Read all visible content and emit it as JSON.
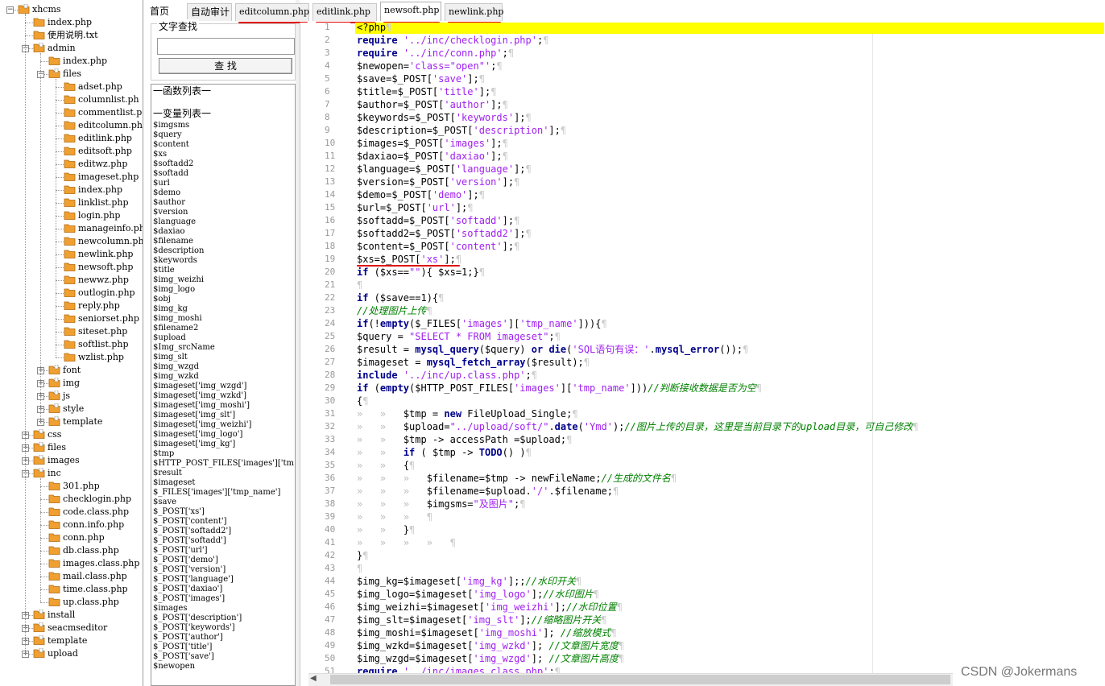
{
  "tree": [
    {
      "label": "xhcms",
      "depth": 0,
      "expander": "-",
      "folder": true
    },
    {
      "label": "index.php",
      "depth": 1,
      "folder": false
    },
    {
      "label": "使用说明.txt",
      "depth": 1,
      "folder": false
    },
    {
      "label": "admin",
      "depth": 1,
      "expander": "-",
      "folder": true
    },
    {
      "label": "index.php",
      "depth": 2,
      "folder": false
    },
    {
      "label": "files",
      "depth": 2,
      "expander": "-",
      "folder": true
    },
    {
      "label": "adset.php",
      "depth": 3,
      "folder": false
    },
    {
      "label": "columnlist.ph",
      "depth": 3,
      "folder": false
    },
    {
      "label": "commentlist.p",
      "depth": 3,
      "folder": false
    },
    {
      "label": "editcolumn.ph",
      "depth": 3,
      "folder": false
    },
    {
      "label": "editlink.php",
      "depth": 3,
      "folder": false
    },
    {
      "label": "editsoft.php",
      "depth": 3,
      "folder": false
    },
    {
      "label": "editwz.php",
      "depth": 3,
      "folder": false
    },
    {
      "label": "imageset.php",
      "depth": 3,
      "folder": false
    },
    {
      "label": "index.php",
      "depth": 3,
      "folder": false
    },
    {
      "label": "linklist.php",
      "depth": 3,
      "folder": false
    },
    {
      "label": "login.php",
      "depth": 3,
      "folder": false
    },
    {
      "label": "manageinfo.ph",
      "depth": 3,
      "folder": false
    },
    {
      "label": "newcolumn.php",
      "depth": 3,
      "folder": false
    },
    {
      "label": "newlink.php",
      "depth": 3,
      "folder": false
    },
    {
      "label": "newsoft.php",
      "depth": 3,
      "folder": false
    },
    {
      "label": "newwz.php",
      "depth": 3,
      "folder": false
    },
    {
      "label": "outlogin.php",
      "depth": 3,
      "folder": false
    },
    {
      "label": "reply.php",
      "depth": 3,
      "folder": false
    },
    {
      "label": "seniorset.php",
      "depth": 3,
      "folder": false
    },
    {
      "label": "siteset.php",
      "depth": 3,
      "folder": false
    },
    {
      "label": "softlist.php",
      "depth": 3,
      "folder": false
    },
    {
      "label": "wzlist.php",
      "depth": 3,
      "folder": false
    },
    {
      "label": "font",
      "depth": 2,
      "expander": "+",
      "folder": true
    },
    {
      "label": "img",
      "depth": 2,
      "expander": "+",
      "folder": true
    },
    {
      "label": "js",
      "depth": 2,
      "expander": "+",
      "folder": true
    },
    {
      "label": "style",
      "depth": 2,
      "expander": "+",
      "folder": true
    },
    {
      "label": "template",
      "depth": 2,
      "expander": "+",
      "folder": true
    },
    {
      "label": "css",
      "depth": 1,
      "expander": "+",
      "folder": true
    },
    {
      "label": "files",
      "depth": 1,
      "expander": "+",
      "folder": true
    },
    {
      "label": "images",
      "depth": 1,
      "expander": "+",
      "folder": true
    },
    {
      "label": "inc",
      "depth": 1,
      "expander": "-",
      "folder": true
    },
    {
      "label": "301.php",
      "depth": 2,
      "folder": false
    },
    {
      "label": "checklogin.php",
      "depth": 2,
      "folder": false
    },
    {
      "label": "code.class.php",
      "depth": 2,
      "folder": false
    },
    {
      "label": "conn.info.php",
      "depth": 2,
      "folder": false
    },
    {
      "label": "conn.php",
      "depth": 2,
      "folder": false
    },
    {
      "label": "db.class.php",
      "depth": 2,
      "folder": false
    },
    {
      "label": "images.class.php",
      "depth": 2,
      "folder": false
    },
    {
      "label": "mail.class.php",
      "depth": 2,
      "folder": false
    },
    {
      "label": "time.class.php",
      "depth": 2,
      "folder": false
    },
    {
      "label": "up.class.php",
      "depth": 2,
      "folder": false
    },
    {
      "label": "install",
      "depth": 1,
      "expander": "+",
      "folder": true
    },
    {
      "label": "seacmseditor",
      "depth": 1,
      "expander": "+",
      "folder": true
    },
    {
      "label": "template",
      "depth": 1,
      "expander": "+",
      "folder": true
    },
    {
      "label": "upload",
      "depth": 1,
      "expander": "+",
      "folder": true
    }
  ],
  "tabs": [
    {
      "label": "首页",
      "active": false,
      "underline": false
    },
    {
      "label": "自动审计",
      "active": false,
      "underline": false
    },
    {
      "label": "editcolumn.php",
      "active": false,
      "underline": true
    },
    {
      "label": "editlink.php",
      "active": false,
      "underline": true
    },
    {
      "label": "newsoft.php",
      "active": true,
      "underline": true
    },
    {
      "label": "newlink.php",
      "active": false,
      "underline": true
    }
  ],
  "search": {
    "legend": "文字查找",
    "button": "查 找",
    "value": ""
  },
  "symbols": {
    "func_header": "一函数列表一",
    "var_header": "一变量列表一",
    "vars": [
      "$imgsms",
      "$query",
      "$content",
      "$xs",
      "$softadd2",
      "$softadd",
      "$url",
      "$demo",
      "$author",
      "$version",
      "$language",
      "$daxiao",
      "$filename",
      "$description",
      "$keywords",
      "$title",
      "$img_weizhi",
      "$img_logo",
      "$obj",
      "$img_kg",
      "$img_moshi",
      "$filename2",
      "$upload",
      "$Img_srcName",
      "$img_slt",
      "$img_wzgd",
      "$img_wzkd",
      "$imageset['img_wzgd']",
      "$imageset['img_wzkd']",
      "$imageset['img_moshi']",
      "$imageset['img_slt']",
      "$imageset['img_weizhi']",
      "$imageset['img_logo']",
      "$imageset['img_kg']",
      "$tmp",
      "$HTTP_POST_FILES['images']['tm",
      "$result",
      "$imageset",
      "$_FILES['images']['tmp_name']",
      "$save",
      "$_POST['xs']",
      "$_POST['content']",
      "$_POST['softadd2']",
      "$_POST['softadd']",
      "$_POST['url']",
      "$_POST['demo']",
      "$_POST['version']",
      "$_POST['language']",
      "$_POST['daxiao']",
      "$_POST['images']",
      "$images",
      "$_POST['description']",
      "$_POST['keywords']",
      "$_POST['author']",
      "$_POST['title']",
      "$_POST['save']",
      "$newopen"
    ]
  },
  "code_lines": [
    "<?php",
    "require '../inc/checklogin.php';",
    "require '../inc/conn.php';",
    "$newopen='class=\"open\"';",
    "$save=$_POST['save'];",
    "$title=$_POST['title'];",
    "$author=$_POST['author'];",
    "$keywords=$_POST['keywords'];",
    "$description=$_POST['description'];",
    "$images=$_POST['images'];",
    "$daxiao=$_POST['daxiao'];",
    "$language=$_POST['language'];",
    "$version=$_POST['version'];",
    "$demo=$_POST['demo'];",
    "$url=$_POST['url'];",
    "$softadd=$_POST['softadd'];",
    "$softadd2=$_POST['softadd2'];",
    "$content=$_POST['content'];",
    "$xs=$_POST['xs'];",
    "if ($xs==\"\"){ $xs=1;}",
    "",
    "if ($save==1){",
    "//处理图片上传",
    "if(!empty($_FILES['images']['tmp_name'])){",
    "$query = \"SELECT * FROM imageset\";",
    "$result = mysql_query($query) or die('SQL语句有误：'.mysql_error());",
    "$imageset = mysql_fetch_array($result);",
    "include '../inc/up.class.php';",
    "if (empty($HTTP_POST_FILES['images']['tmp_name']))//判断接收数据是否为空",
    "{",
    "\t\t$tmp = new FileUpload_Single;",
    "\t\t$upload=\"../upload/soft/\".date('Ymd');//图片上传的目录，这里是当前目录下的upload目录，可自己修改",
    "\t\t$tmp -> accessPath =$upload;",
    "\t\tif ( $tmp -> TODO() )",
    "\t\t{",
    "\t\t\t$filename=$tmp -> newFileName;//生成的文件名",
    "\t\t\t$filename=$upload.'/'.$filename;",
    "\t\t\t$imgsms=\"及图片\";",
    "\t\t\t",
    "\t\t}",
    "\t\t\t\t",
    "}",
    "",
    "$img_kg=$imageset['img_kg'];;//水印开关",
    "$img_logo=$imageset['img_logo'];//水印图片",
    "$img_weizhi=$imageset['img_weizhi'];//水印位置",
    "$img_slt=$imageset['img_slt'];//缩略图片开关",
    "$img_moshi=$imageset['img_moshi']; //缩放模式",
    "$img_wzkd=$imageset['img_wzkd']; //文章图片宽度",
    "$img_wzgd=$imageset['img_wzgd']; //文章图片高度",
    "require '../inc/images.class.php';"
  ],
  "watermark": "CSDN @Jokermans",
  "colors": {
    "highlight": "#ffff00",
    "keyword": "#00008b",
    "string": "#a020f0",
    "comment": "#008000",
    "annotation": "#e00000",
    "folder": "#f0a030"
  }
}
